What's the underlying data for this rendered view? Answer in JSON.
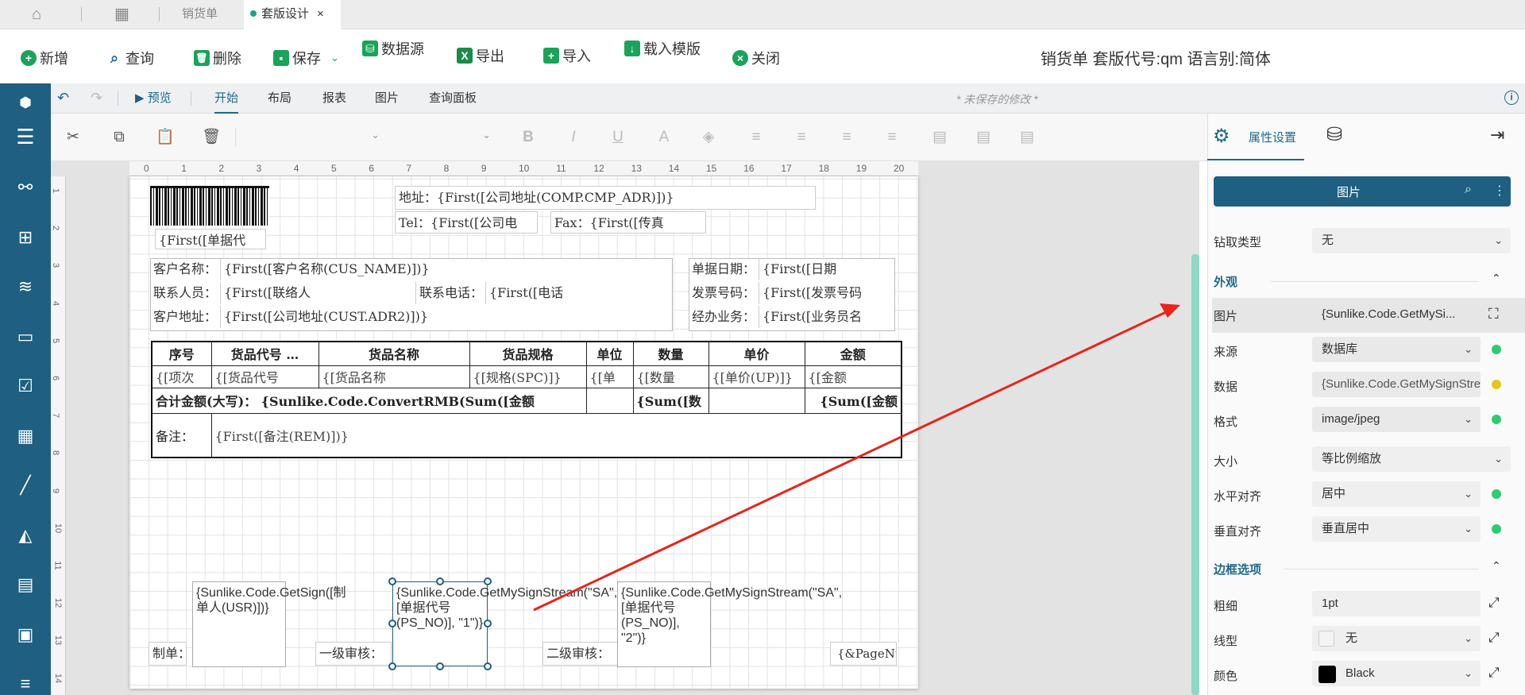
{
  "tabs": {
    "sales_doc": "销货单",
    "template_design": "套版设计"
  },
  "toolbar": {
    "new": "新增",
    "query": "查询",
    "delete": "删除",
    "save": "保存",
    "datasource": "数据源",
    "export": "导出",
    "import": "导入",
    "load_template": "载入模版",
    "close": "关闭"
  },
  "doc_info": "销货单 套版代号:qm 语言别:简体",
  "ribbon": {
    "preview": "预览",
    "tabs": [
      "开始",
      "布局",
      "报表",
      "图片",
      "查询面板"
    ],
    "unsaved": "* 未保存的修改 *"
  },
  "ruler_h": [
    "0",
    "1",
    "2",
    "3",
    "4",
    "5",
    "6",
    "7",
    "8",
    "9",
    "10",
    "11",
    "12",
    "13",
    "14",
    "15",
    "16",
    "17",
    "18",
    "19",
    "20"
  ],
  "ruler_v": [
    "1",
    "2",
    "3",
    "4",
    "5",
    "6",
    "7",
    "8",
    "9",
    "10",
    "11",
    "12",
    "13",
    "14"
  ],
  "report": {
    "barcode_text": "{First([单据代",
    "address": "地址：{First([公司地址(COMP.CMP_ADR)])}",
    "tel": "Tel：{First([公司电",
    "fax": "Fax：{First([传真",
    "cus_name_label": "客户名称：",
    "cus_name": "{First([客户名称(CUS_NAME)])}",
    "contact_label": "联系人员：",
    "contact": "{First([联络人",
    "phone_label": "联系电话：",
    "phone": "{First([电话",
    "cus_addr_label": "客户地址：",
    "cus_addr": "{First([公司地址(CUST.ADR2)])}",
    "date_label": "单据日期：",
    "date": "{First([日期",
    "invoice_label": "发票号码：",
    "invoice": "{First([发票号码",
    "sales_label": "经办业务：",
    "sales": "{First([业务员名",
    "table_headers": [
      "序号",
      "货品代号 …",
      "货品名称",
      "货品规格",
      "单位",
      "数量",
      "单价",
      "金额"
    ],
    "table_row": [
      "{[项次",
      "{[货品代号",
      "{[货品名称",
      "{[规格(SPC)]}",
      "{[单",
      "{[数量",
      "{[单价(UP)]}",
      "{[金额"
    ],
    "total_label": "合计金额(大写)：",
    "total_expr": "{Sunlike.Code.ConvertRMB(Sum([金额",
    "total_qty": "{Sum([数",
    "total_amt": "{Sum([金额",
    "remark_label": "备注：",
    "remark": "{First([备注(REM)])}",
    "maker_label": "制单：",
    "maker_sign": "{Sunlike.Code.GetSign([制单人(USR)])}",
    "audit1_label": "一级审核：",
    "audit1_sign": "{Sunlike.Code.GetMySignStream(\"SA\", [单据代号(PS_NO)], \"1\")}",
    "audit2_label": "二级审核：",
    "audit2_sign": "{Sunlike.Code.GetMySignStream(\"SA\", [单据代号(PS_NO)], \"2\")}",
    "page_num": "{&PageNu"
  },
  "panel": {
    "tab_label": "属性设置",
    "object_name": "图片",
    "drill_label": "钻取类型",
    "drill_value": "无",
    "appearance": "外观",
    "image_label": "图片",
    "image_value": "{Sunlike.Code.GetMySi...",
    "source_label": "来源",
    "source_value": "数据库",
    "data_label": "数据",
    "data_value": "{Sunlike.Code.GetMySignStre",
    "format_label": "格式",
    "format_value": "image/jpeg",
    "size_label": "大小",
    "size_value": "等比例缩放",
    "halign_label": "水平对齐",
    "halign_value": "居中",
    "valign_label": "垂直对齐",
    "valign_value": "垂直居中",
    "border_section": "边框选项",
    "thickness_label": "粗细",
    "thickness_value": "1pt",
    "linetype_label": "线型",
    "linetype_value": "无",
    "color_label": "颜色",
    "color_value": "Black"
  },
  "colors": {
    "accent": "#1e5f82",
    "green_dot": "#2ecc71",
    "yellow_dot": "#e6c619",
    "arrow": "#e8241c"
  }
}
